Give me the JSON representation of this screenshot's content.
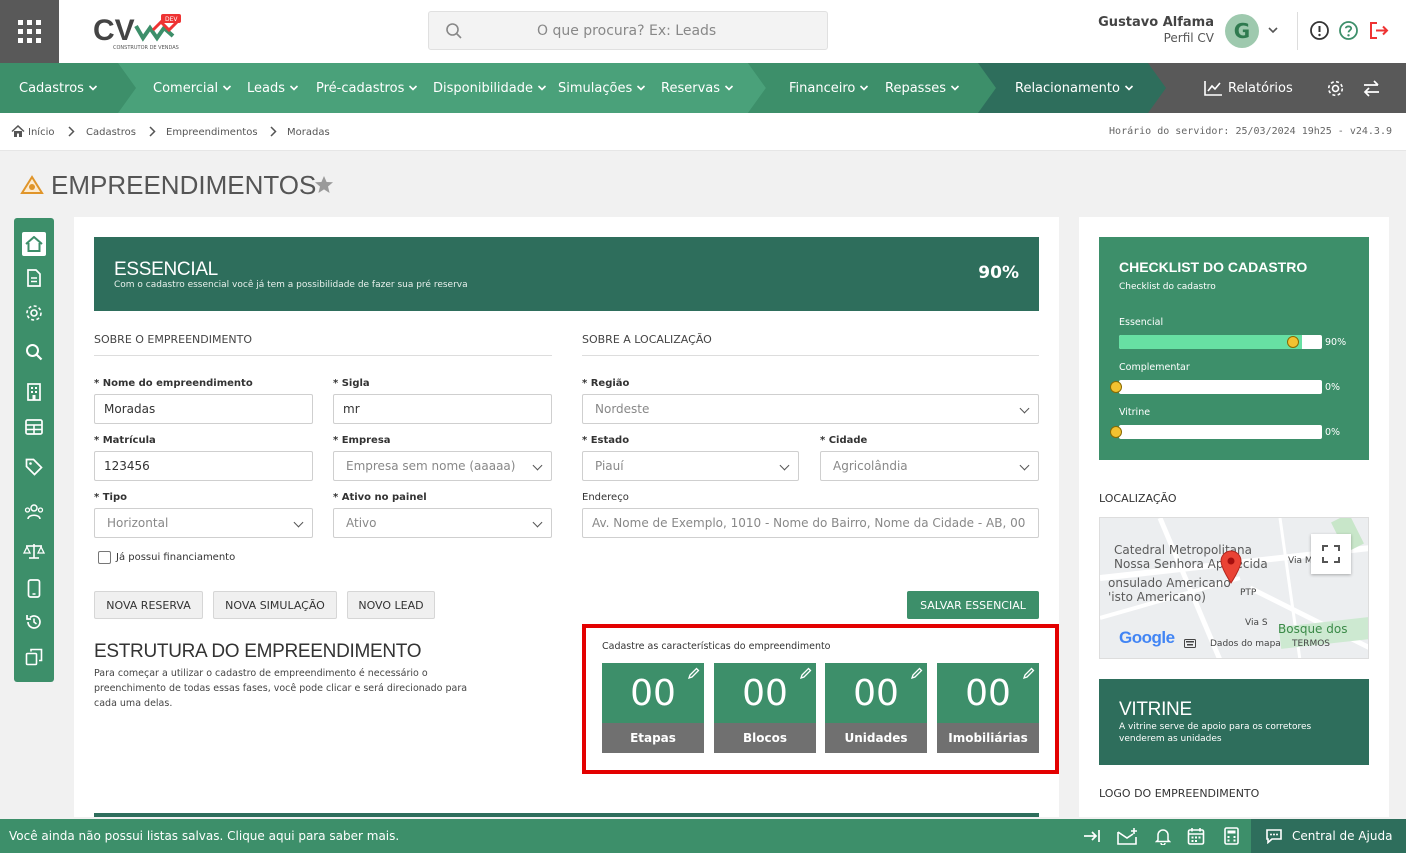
{
  "header": {
    "logo_text": "CV",
    "logo_badge": "DEV",
    "logo_caption": "CONSTRUTOR DE VENDAS",
    "search_placeholder": "O que procura? Ex: Leads",
    "user_name": "Gustavo Alfama",
    "user_role": "Perfil CV",
    "avatar_initial": "G"
  },
  "nav": {
    "items": [
      "Cadastros",
      "Comercial",
      "Leads",
      "Pré-cadastros",
      "Disponibilidade",
      "Simulações",
      "Reservas",
      "Financeiro",
      "Repasses",
      "Relacionamento"
    ],
    "reports": "Relatórios",
    "colors": {
      "primary": "#3d8f6a",
      "dark": "#2e6e5c",
      "gray": "#595959"
    }
  },
  "breadcrumb": {
    "items": [
      "Início",
      "Cadastros",
      "Empreendimentos",
      "Moradas"
    ],
    "server_time": "Horário do servidor: 25/03/2024 19h25 - v24.3.9"
  },
  "page": {
    "title": "EMPREENDIMENTOS"
  },
  "essencial": {
    "title": "ESSENCIAL",
    "subtitle": "Com o cadastro essencial você já tem a possibilidade de fazer sua pré reserva",
    "percent": "90%"
  },
  "form": {
    "section_about": "SOBRE O EMPREENDIMENTO",
    "section_location": "SOBRE A LOCALIZAÇÃO",
    "nome_label": "Nome do empreendimento",
    "nome_value": "Moradas",
    "sigla_label": "Sigla",
    "sigla_value": "mr",
    "matricula_label": "Matrícula",
    "matricula_value": "123456",
    "empresa_label": "Empresa",
    "empresa_value": "Empresa sem nome (aaaaa)",
    "tipo_label": "Tipo",
    "tipo_value": "Horizontal",
    "ativo_label": "Ativo no painel",
    "ativo_value": "Ativo",
    "regiao_label": "Região",
    "regiao_value": "Nordeste",
    "estado_label": "Estado",
    "estado_value": "Piauí",
    "cidade_label": "Cidade",
    "cidade_value": "Agricolândia",
    "endereco_label": "Endereço",
    "endereco_placeholder": "Av. Nome de Exemplo, 1010 - Nome do Bairro, Nome da Cidade - AB, 00",
    "financiamento_label": "Já possui financiamento",
    "required_mark": "*"
  },
  "actions": {
    "nova_reserva": "NOVA RESERVA",
    "nova_simulacao": "NOVA SIMULAÇÃO",
    "novo_lead": "NOVO LEAD",
    "salvar": "SALVAR ESSENCIAL"
  },
  "estrutura": {
    "title": "ESTRUTURA DO EMPREENDIMENTO",
    "description": "Para começar a utilizar o cadastro de empreendimento é necessário o preenchimento de todas essas fases, você pode clicar e será direcionado para cada uma delas.",
    "caption": "Cadastre as características do empreendimento",
    "tiles": [
      {
        "count": "00",
        "label": "Etapas"
      },
      {
        "count": "00",
        "label": "Blocos"
      },
      {
        "count": "00",
        "label": "Unidades"
      },
      {
        "count": "00",
        "label": "Imobiliárias"
      }
    ]
  },
  "checklist": {
    "title": "CHECKLIST DO CADASTRO",
    "subtitle": "Checklist do cadastro",
    "items": [
      {
        "label": "Essencial",
        "percent": "90%",
        "fraction": 0.9
      },
      {
        "label": "Complementar",
        "percent": "0%",
        "fraction": 0
      },
      {
        "label": "Vitrine",
        "percent": "0%",
        "fraction": 0
      }
    ]
  },
  "location": {
    "title": "LOCALIZAÇÃO",
    "map_labels": [
      "Catedral Metropolitana",
      "Nossa Senhora Aparecida",
      "onsulado Americano",
      "'isto Americano)",
      "Bosque dos",
      "Via M",
      "PTP",
      "Via S"
    ],
    "attribution": "Dados do mapa",
    "terms": "TERMOS",
    "google": "Google"
  },
  "vitrine": {
    "title": "VITRINE",
    "subtitle": "A vitrine serve de apoio para os corretores venderem as unidades"
  },
  "logo_section": {
    "title": "LOGO DO EMPREENDIMENTO"
  },
  "footer": {
    "message": "Você ainda não possui listas salvas. Clique aqui para saber mais.",
    "help": "Central de Ajuda"
  }
}
